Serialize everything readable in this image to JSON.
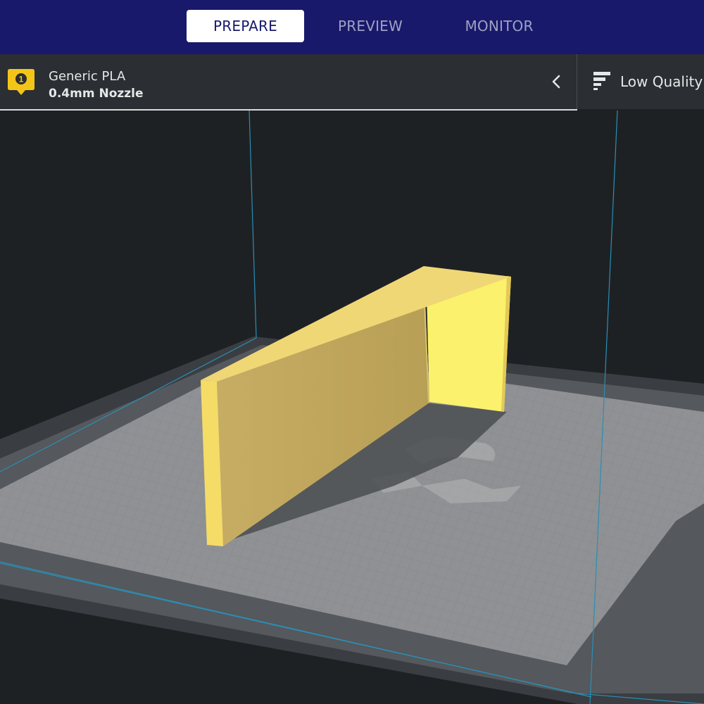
{
  "stages": {
    "prepare": "PREPARE",
    "preview": "PREVIEW",
    "monitor": "MONITOR",
    "active": "prepare"
  },
  "extruder": {
    "number": "1",
    "material": "Generic PLA",
    "nozzle": "0.4mm Nozzle",
    "badge_color": "#f3c518"
  },
  "print_settings": {
    "quality_label": "Low Quality"
  },
  "viewport": {
    "model_color": "#f7e06a",
    "build_volume_line_color": "#2a8fb5",
    "build_plate_color": "#8f9194"
  },
  "colors": {
    "header_bg": "#18196a",
    "bar_bg": "#2b2e32",
    "viewport_bg": "#1e2124"
  }
}
